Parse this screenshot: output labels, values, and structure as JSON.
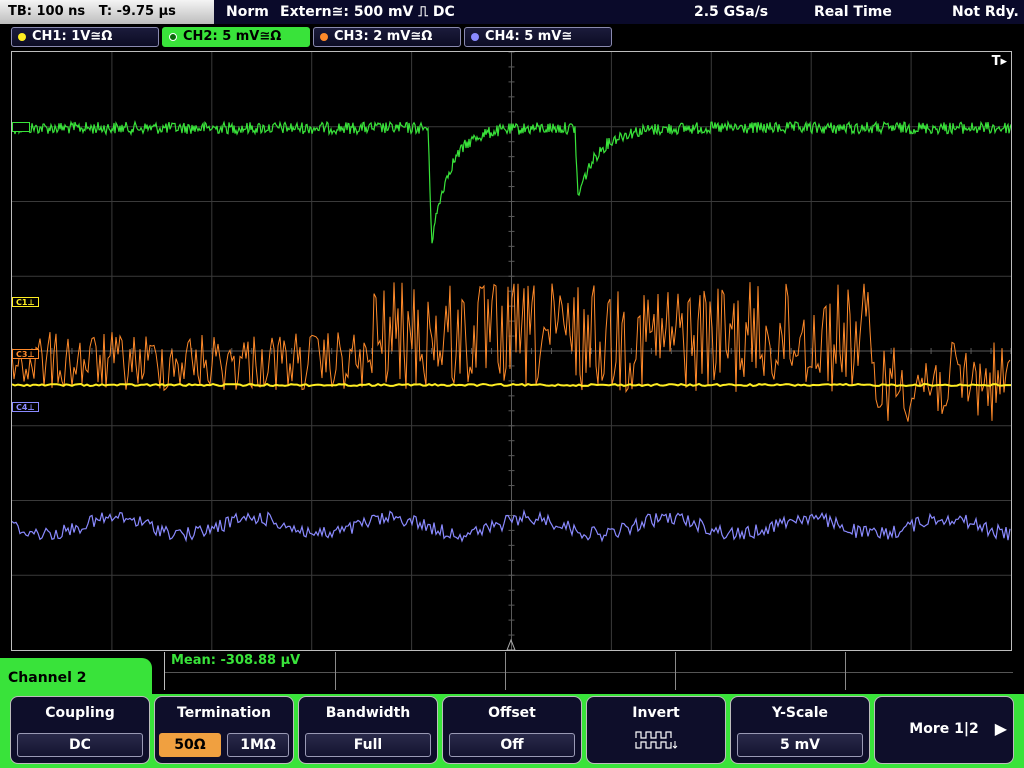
{
  "status_bar": {
    "timebase": "TB: 100 ns   T: -9.75 µs",
    "trigger_mode": "Norm",
    "trigger_source": "Extern≅: 500 mV ⎍ DC",
    "sample_rate": "2.5 GSa/s",
    "acq_mode": "Real Time",
    "status": "Not Rdy."
  },
  "channels": [
    {
      "label": "CH1: 1V≅Ω",
      "color": "#ffee22",
      "active": false
    },
    {
      "label": "CH2: 5 mV≅Ω",
      "color": "#39e33a",
      "active": true
    },
    {
      "label": "CH3: 2 mV≅Ω",
      "color": "#ff8a2a",
      "active": false
    },
    {
      "label": "CH4: 5 mV≅",
      "color": "#8a8aff",
      "active": false
    }
  ],
  "markers": {
    "c1": "C1⊥",
    "c3": "C3⊥",
    "c4": "C4⊥",
    "trigger": "T▸"
  },
  "measurement": {
    "mean": "Mean: -308.88 µV"
  },
  "channel_menu": {
    "title": "Channel 2"
  },
  "softkeys": {
    "coupling": {
      "title": "Coupling",
      "value": "DC"
    },
    "termination": {
      "title": "Termination",
      "opt1": "50Ω",
      "opt2": "1MΩ",
      "selected": "50Ω"
    },
    "bandwidth": {
      "title": "Bandwidth",
      "value": "Full"
    },
    "offset": {
      "title": "Offset",
      "value": "Off"
    },
    "invert": {
      "title": "Invert"
    },
    "yscale": {
      "title": "Y-Scale",
      "value": "5 mV"
    },
    "more": {
      "title": "More 1|2"
    }
  }
}
